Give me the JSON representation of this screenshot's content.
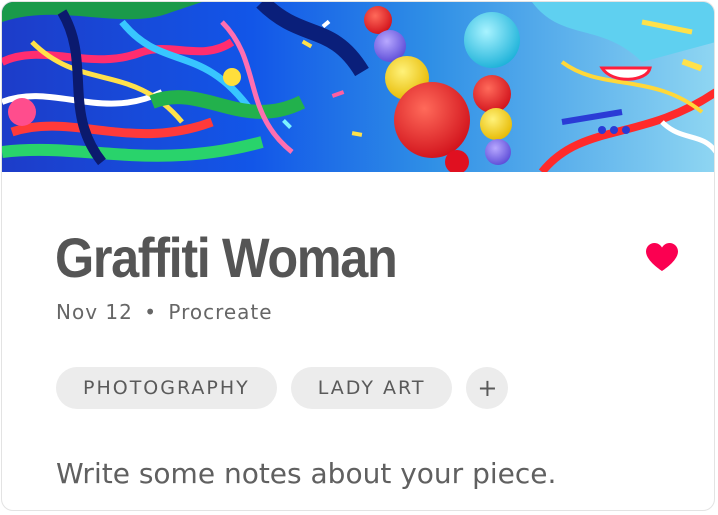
{
  "artwork": {
    "image": "graffiti-woman-artwork",
    "title": "Graffiti Woman",
    "date": "Nov 12",
    "separator": "•",
    "app": "Procreate",
    "favorite": true,
    "favorite_icon": "heart-icon",
    "favorite_color": "#fb0051"
  },
  "tags": {
    "items": [
      "PHOTOGRAPHY",
      "LADY ART"
    ],
    "add_label": "+"
  },
  "notes": {
    "placeholder": "Write some notes about your piece."
  }
}
